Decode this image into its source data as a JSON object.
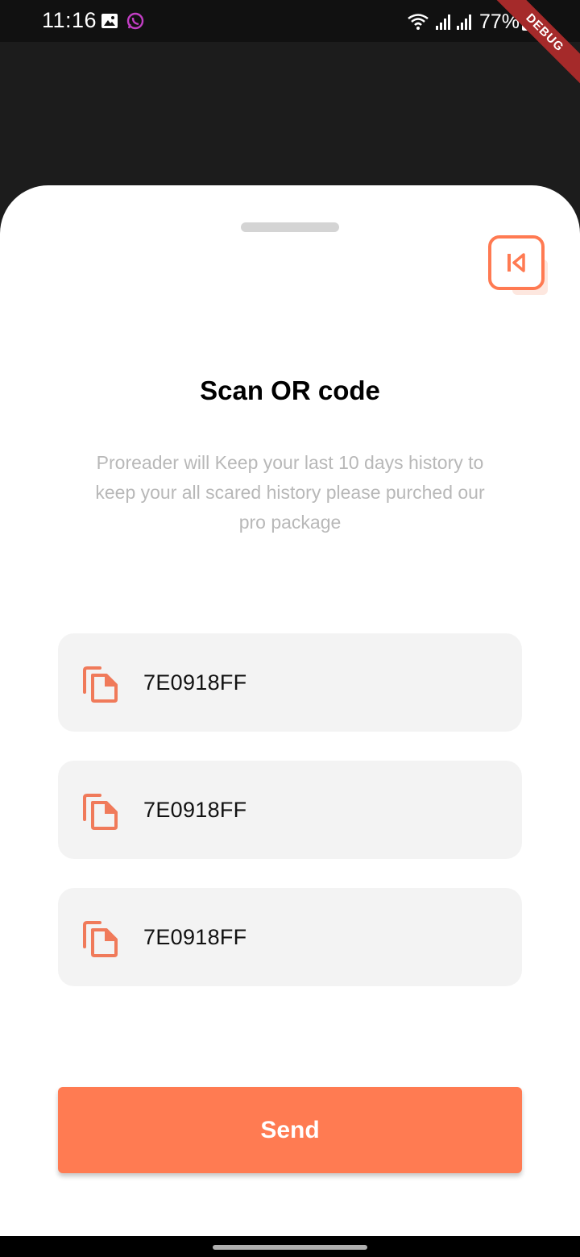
{
  "status_bar": {
    "time": "11:16",
    "battery": "77%",
    "icons": [
      "image-icon",
      "whatsapp-icon",
      "wifi-icon",
      "signal-icon",
      "signal-icon",
      "battery-icon"
    ]
  },
  "debug_banner": "DEBUG",
  "sheet": {
    "title": "Scan OR code",
    "description": "Proreader will Keep your last 10 days history to keep your all scared history please purched our pro package",
    "codes": [
      {
        "value": "7E0918FF",
        "icon": "copy-icon"
      },
      {
        "value": "7E0918FF",
        "icon": "copy-icon"
      },
      {
        "value": "7E0918FF",
        "icon": "copy-icon"
      }
    ],
    "send_label": "Send"
  },
  "colors": {
    "accent": "#ff7b52",
    "sheet_background": "#ffffff",
    "item_background": "#f3f3f3",
    "description_text": "#b8b8b8"
  }
}
